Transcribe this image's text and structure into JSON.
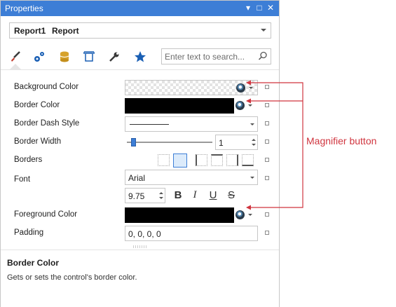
{
  "window": {
    "title": "Properties"
  },
  "selector": {
    "name": "Report1",
    "type": "Report"
  },
  "tabs": [
    {
      "icon": "brush-icon"
    },
    {
      "icon": "gears-icon"
    },
    {
      "icon": "database-icon"
    },
    {
      "icon": "layout-icon"
    },
    {
      "icon": "wrench-icon"
    },
    {
      "icon": "star-icon"
    }
  ],
  "search": {
    "placeholder": "Enter text to search..."
  },
  "properties": {
    "background_color": {
      "label": "Background Color"
    },
    "border_color": {
      "label": "Border Color"
    },
    "border_dash_style": {
      "label": "Border Dash Style"
    },
    "border_width": {
      "label": "Border Width",
      "value": "1",
      "slider_fraction": 0.05
    },
    "borders": {
      "label": "Borders"
    },
    "font": {
      "label": "Font",
      "name": "Arial",
      "size": "9.75",
      "bold": "B",
      "italic": "I",
      "underline": "U",
      "strike": "S"
    },
    "foreground_color": {
      "label": "Foreground Color"
    },
    "padding": {
      "label": "Padding",
      "value": "0, 0, 0, 0"
    }
  },
  "description": {
    "title": "Border Color",
    "text": "Gets or sets the control's border color."
  },
  "annotation": {
    "text": "Magnifier button",
    "color": "#d0353f"
  },
  "colors": {
    "accent": "#3d7ed6",
    "brush": "#c0392b",
    "tab_blue": "#1a5fb4",
    "db": "#d6a22b"
  }
}
